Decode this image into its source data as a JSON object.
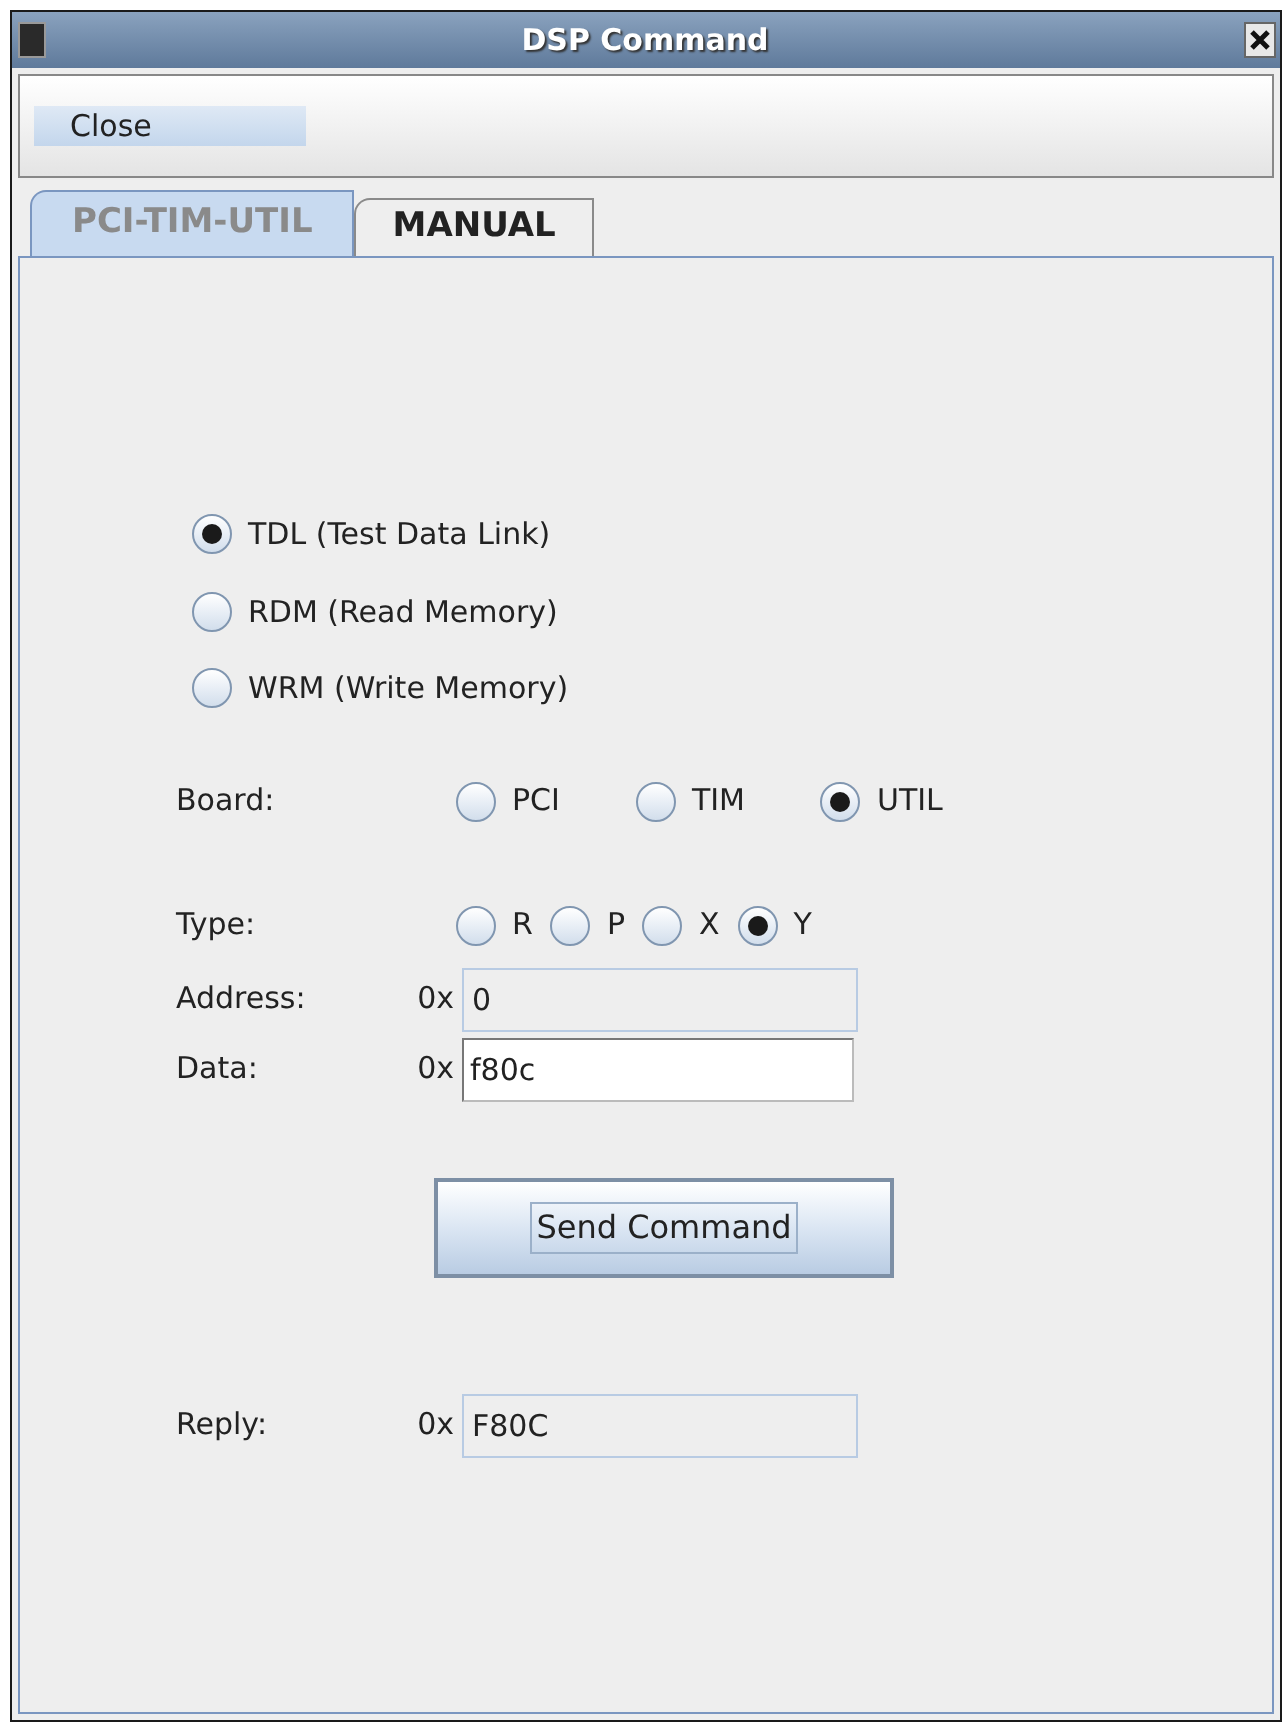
{
  "window": {
    "title": "DSP Command"
  },
  "toolbar": {
    "close_button": "Close"
  },
  "tabs": [
    {
      "label": "PCI-TIM-UTIL",
      "selected": true
    },
    {
      "label": "MANUAL",
      "selected": false
    }
  ],
  "commands": [
    {
      "label": "TDL (Test Data Link)",
      "selected": true
    },
    {
      "label": "RDM (Read Memory)",
      "selected": false
    },
    {
      "label": "WRM (Write Memory)",
      "selected": false
    }
  ],
  "board": {
    "label": "Board:",
    "options": [
      {
        "label": "PCI",
        "selected": false
      },
      {
        "label": "TIM",
        "selected": false
      },
      {
        "label": "UTIL",
        "selected": true
      }
    ]
  },
  "type": {
    "label": "Type:",
    "options": [
      {
        "label": "R",
        "selected": false
      },
      {
        "label": "P",
        "selected": false
      },
      {
        "label": "X",
        "selected": false
      },
      {
        "label": "Y",
        "selected": true
      }
    ]
  },
  "address": {
    "label": "Address:",
    "prefix": "0x",
    "value": "0",
    "editable": false
  },
  "data": {
    "label": "Data:",
    "prefix": "0x",
    "value": "f80c",
    "editable": true
  },
  "send_button": "Send Command",
  "reply": {
    "label": "Reply:",
    "prefix": "0x",
    "value": "F80C",
    "editable": false
  }
}
